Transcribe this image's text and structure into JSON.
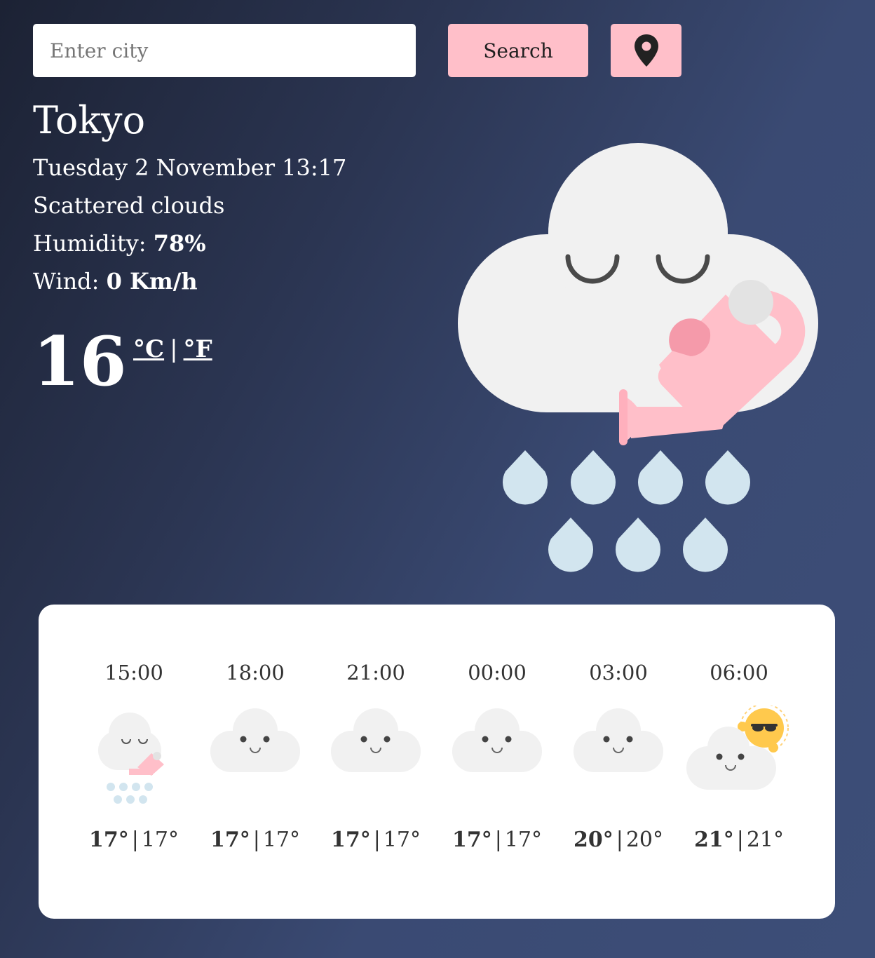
{
  "search": {
    "placeholder": "Enter city",
    "button_label": "Search"
  },
  "location_button": {
    "icon": "map-pin-icon"
  },
  "current": {
    "city": "Tokyo",
    "datetime": "Tuesday 2 November 13:17",
    "description": "Scattered clouds",
    "humidity_label": "Humidity:",
    "humidity_value": "78%",
    "wind_label": "Wind:",
    "wind_value": "0 Km/h",
    "temperature": "16",
    "unit_celsius": "°C",
    "unit_separator": "|",
    "unit_fahrenheit": "°F",
    "icon": "rain-cloud-watering-can-icon"
  },
  "forecast": [
    {
      "time": "15:00",
      "max": "17°",
      "min": "17°",
      "icon": "rain-cloud-icon"
    },
    {
      "time": "18:00",
      "max": "17°",
      "min": "17°",
      "icon": "cloud-icon"
    },
    {
      "time": "21:00",
      "max": "17°",
      "min": "17°",
      "icon": "cloud-icon"
    },
    {
      "time": "00:00",
      "max": "17°",
      "min": "17°",
      "icon": "cloud-icon"
    },
    {
      "time": "03:00",
      "max": "20°",
      "min": "20°",
      "icon": "cloud-icon"
    },
    {
      "time": "06:00",
      "max": "21°",
      "min": "21°",
      "icon": "sun-behind-cloud-icon"
    }
  ],
  "colors": {
    "accent_pink": "#ffbfc9",
    "cloud": "#f1f1f1",
    "raindrop": "#d2e5ef",
    "sun": "#ffc94d"
  }
}
